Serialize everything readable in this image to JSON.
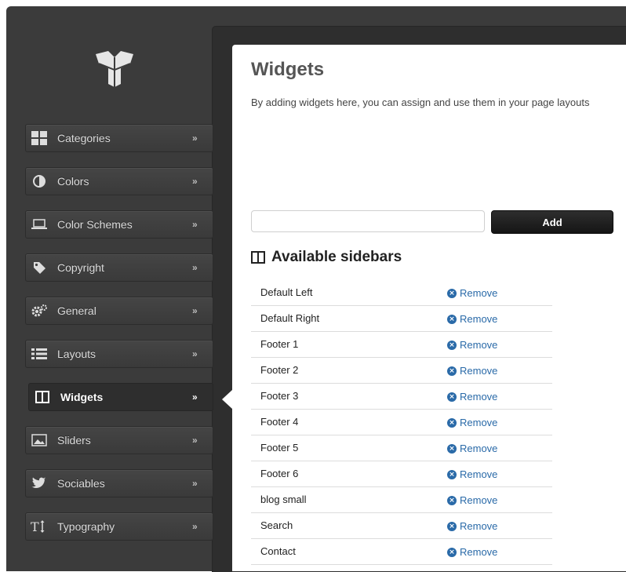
{
  "nav": {
    "items": [
      {
        "label": "Categories",
        "icon": "grid-icon"
      },
      {
        "label": "Colors",
        "icon": "contrast-icon"
      },
      {
        "label": "Color Schemes",
        "icon": "laptop-icon"
      },
      {
        "label": "Copyright",
        "icon": "tag-icon"
      },
      {
        "label": "General",
        "icon": "gears-icon"
      },
      {
        "label": "Layouts",
        "icon": "list-icon"
      },
      {
        "label": "Widgets",
        "icon": "columns-icon",
        "active": true
      },
      {
        "label": "Sliders",
        "icon": "picture-icon"
      },
      {
        "label": "Sociables",
        "icon": "twitter-icon"
      },
      {
        "label": "Typography",
        "icon": "text-height-icon"
      }
    ],
    "chevron": "»"
  },
  "content": {
    "title": "Widgets",
    "subtitle": "By adding widgets here, you can assign and use them in your page layouts",
    "input_value": "",
    "add_label": "Add",
    "section_title": "Available sidebars",
    "remove_label": "Remove",
    "sidebars": [
      "Default Left",
      "Default Right",
      "Footer 1",
      "Footer 2",
      "Footer 3",
      "Footer 4",
      "Footer 5",
      "Footer 6",
      "blog small",
      "Search",
      "Contact"
    ]
  },
  "colors": {
    "link": "#2a6aa8",
    "sidebar_bg": "#3b3b3b",
    "button_bg": "#1e1e1e"
  }
}
